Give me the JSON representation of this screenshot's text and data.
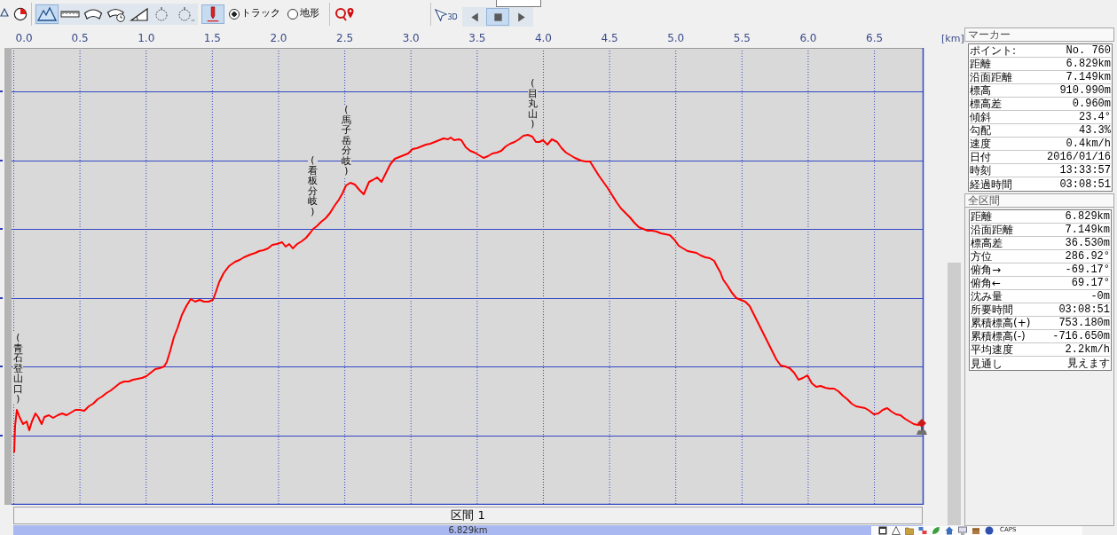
{
  "toolbar": {
    "profile_tools": [
      {
        "selected": true
      },
      {
        "selected": false
      },
      {
        "selected": false
      },
      {
        "selected": false
      },
      {
        "selected": false
      },
      {
        "selected": false
      },
      {
        "selected": false
      }
    ],
    "pen_button": {
      "on": true
    },
    "mode_options": [
      {
        "label": "トラック",
        "selected": true
      },
      {
        "label": "地形",
        "selected": false
      }
    ],
    "view_3d_button": {
      "label": "3D"
    },
    "playback_buttons": [
      {
        "selected": false
      },
      {
        "selected": true
      },
      {
        "selected": false
      }
    ]
  },
  "axis": {
    "ticks": [
      "0.0",
      "0.5",
      "1.0",
      "1.5",
      "2.0",
      "2.5",
      "3.0",
      "3.5",
      "4.0",
      "4.5",
      "5.0",
      "5.5",
      "6.0",
      "6.5"
    ],
    "unit": "[km]"
  },
  "waypoints": [
    {
      "label": "(青石登山口)"
    },
    {
      "label": "(看板分岐)"
    },
    {
      "label": "(馬子岳分岐)"
    },
    {
      "label": "(目丸山)"
    }
  ],
  "section": {
    "title": "区間 1",
    "distance": "6.829km"
  },
  "marker_panel": {
    "title": "マーカー",
    "rows": [
      {
        "label": "ポイント:",
        "value": "No. 760"
      },
      {
        "label": "距離",
        "value": "6.829km"
      },
      {
        "label": "沿面距離",
        "value": "7.149km"
      },
      {
        "label": "標高",
        "value": "910.990m"
      },
      {
        "label": "標高差",
        "value": "0.960m"
      },
      {
        "label": "傾斜",
        "value": "23.4°"
      },
      {
        "label": "勾配",
        "value": "43.3%"
      },
      {
        "label": "速度",
        "value": "0.4km/h"
      },
      {
        "label": "日付",
        "value": "2016/01/16"
      },
      {
        "label": "時刻",
        "value": "13:33:57"
      },
      {
        "label": "経過時間",
        "value": "03:08:51"
      }
    ]
  },
  "total_panel": {
    "title": "全区間",
    "rows": [
      {
        "label": "距離",
        "value": "6.829km"
      },
      {
        "label": "沿面距離",
        "value": "7.149km"
      },
      {
        "label": "標高差",
        "value": "36.530m"
      },
      {
        "label": "方位",
        "value": "286.92°"
      },
      {
        "label": "俯角→",
        "value": "-69.17°"
      },
      {
        "label": "俯角←",
        "value": "69.17°"
      },
      {
        "label": "沈み量",
        "value": "-0m"
      },
      {
        "label": "所要時間",
        "value": "03:08:51"
      },
      {
        "label": "累積標高(+)",
        "value": "753.180m"
      },
      {
        "label": "累積標高(-)",
        "value": "-716.650m"
      },
      {
        "label": "平均速度",
        "value": "2.2km/h"
      },
      {
        "label": "見通し",
        "value": "見えます"
      }
    ]
  },
  "status_tray": {
    "caps": "CAPS"
  }
}
